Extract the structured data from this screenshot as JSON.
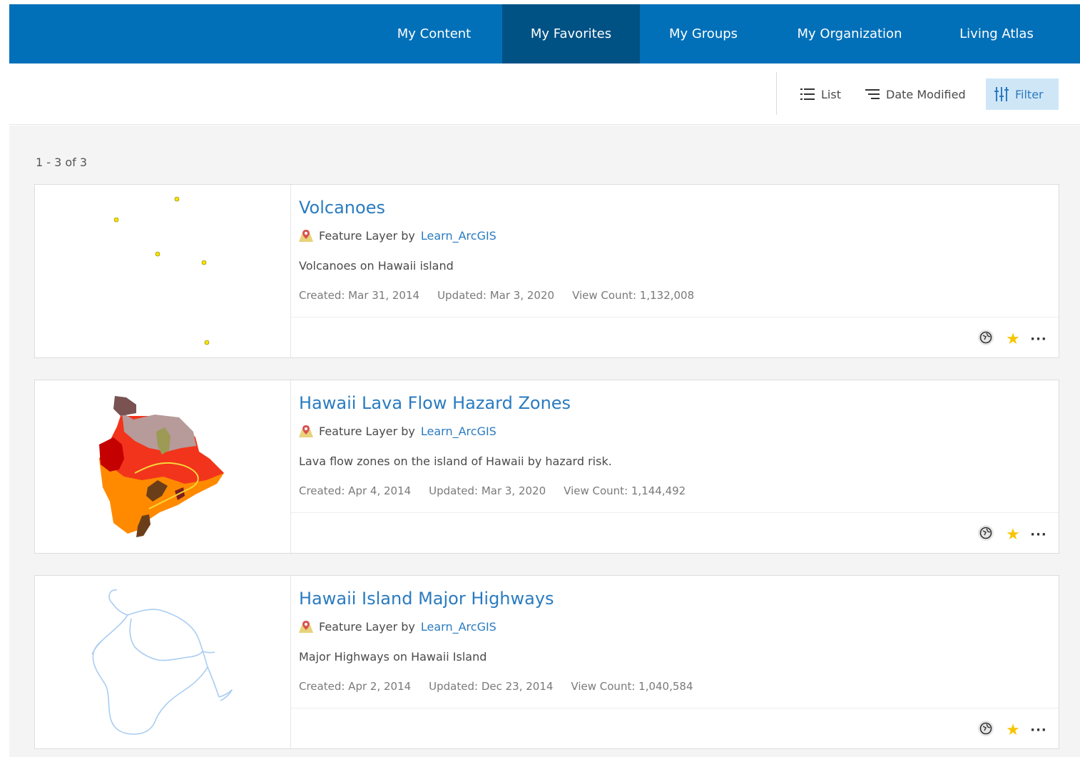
{
  "nav": {
    "tabs": [
      {
        "label": "My Content",
        "active": false
      },
      {
        "label": "My Favorites",
        "active": true
      },
      {
        "label": "My Groups",
        "active": false
      },
      {
        "label": "My Organization",
        "active": false
      },
      {
        "label": "Living Atlas",
        "active": false
      }
    ]
  },
  "toolbar": {
    "view_label": "List",
    "sort_label": "Date Modified",
    "filter_label": "Filter"
  },
  "results": {
    "count_text": "1 - 3 of 3",
    "items": [
      {
        "title": "Volcanoes",
        "type_text": "Feature Layer by",
        "author": "Learn_ArcGIS",
        "description": "Volcanoes on Hawaii island",
        "created": "Created: Mar 31, 2014",
        "updated": "Updated: Mar 3, 2020",
        "views": "View Count: 1,132,008"
      },
      {
        "title": "Hawaii Lava Flow Hazard Zones",
        "type_text": "Feature Layer by",
        "author": "Learn_ArcGIS",
        "description": "Lava flow zones on the island of Hawaii by hazard risk.",
        "created": "Created: Apr 4, 2014",
        "updated": "Updated: Mar 3, 2020",
        "views": "View Count: 1,144,492"
      },
      {
        "title": "Hawaii Island Major Highways",
        "type_text": "Feature Layer by",
        "author": "Learn_ArcGIS",
        "description": "Major Highways on Hawaii Island",
        "created": "Created: Apr 2, 2014",
        "updated": "Updated: Dec 23, 2014",
        "views": "View Count: 1,040,584"
      }
    ]
  },
  "actions": {
    "favorite_glyph": "★",
    "more_glyph": "···"
  },
  "colors": {
    "nav_bg": "#0270b8",
    "nav_active_bg": "#005184",
    "link": "#2a7bc0",
    "favorite": "#f7c500",
    "filter_active_bg": "#cfe6f7"
  },
  "icons": [
    "list-icon",
    "sort-icon",
    "filter-icon",
    "feature-layer-icon",
    "share-icon",
    "star-icon",
    "more-icon"
  ]
}
